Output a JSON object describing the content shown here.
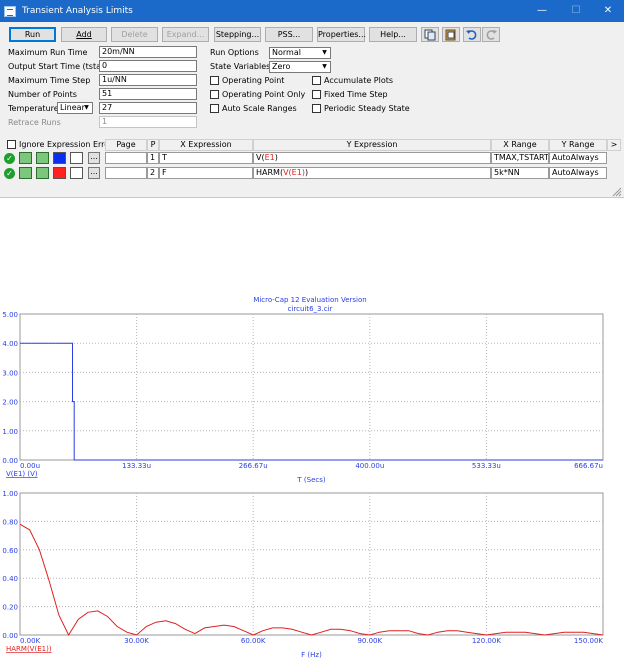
{
  "window": {
    "title": "Transient Analysis Limits",
    "controls": [
      "—",
      "☐",
      "✕"
    ]
  },
  "toolbar": {
    "run": "Run",
    "add": "Add",
    "delete": "Delete",
    "expand": "Expand...",
    "stepping": "Stepping...",
    "pss": "PSS...",
    "properties": "Properties...",
    "help": "Help..."
  },
  "fields": {
    "max_run_time": {
      "label": "Maximum Run Time",
      "value": "20m/NN"
    },
    "output_start": {
      "label": "Output Start Time (tstart)",
      "value": "0"
    },
    "max_time_step": {
      "label": "Maximum Time Step",
      "value": "1u/NN"
    },
    "num_points": {
      "label": "Number of Points",
      "value": "51"
    },
    "temperature": {
      "label": "Temperature",
      "mode": "Linear",
      "value": "27"
    },
    "retrace_runs": {
      "label": "Retrace Runs",
      "value": "1"
    }
  },
  "options": {
    "run_options_label": "Run Options",
    "run_options_value": "Normal",
    "state_variables_label": "State Variables",
    "state_variables_value": "Zero",
    "checks": {
      "operating_point": "Operating Point",
      "operating_point_only": "Operating Point Only",
      "auto_scale_ranges": "Auto Scale Ranges",
      "accumulate_plots": "Accumulate Plots",
      "fixed_time_step": "Fixed Time Step",
      "periodic_steady_state": "Periodic Steady State"
    }
  },
  "grid": {
    "ignore_label": "Ignore Expression Errors",
    "headers": {
      "page": "Page",
      "p": "P",
      "x": "X Expression",
      "y": "Y Expression",
      "xrange": "X Range",
      "yrange": "Y Range",
      "more": ">"
    },
    "rows": [
      {
        "page": "",
        "p": "1",
        "x": "T",
        "y_prefix": "V(",
        "y_mid": "E1",
        "y_suffix": ")",
        "xrange": "TMAX,TSTART",
        "yrange": "AutoAlways",
        "color": "#0a2ef0"
      },
      {
        "page": "",
        "p": "2",
        "x": "F",
        "y_prefix": "HARM(",
        "y_mid": "V(E1)",
        "y_suffix": ")",
        "xrange": "5k*NN",
        "yrange": "AutoAlways",
        "color": "#ff2020"
      }
    ]
  },
  "plot": {
    "header1": "Micro-Cap 12 Evaluation Version",
    "header2": "circuit6_3.cir",
    "top": {
      "ylabels": [
        "5.00",
        "4.00",
        "3.00",
        "2.00",
        "1.00",
        "0.00"
      ],
      "xlabels": [
        "0.00u",
        "133.33u",
        "266.67u",
        "400.00u",
        "533.33u",
        "666.67u"
      ],
      "trace_label": "V(E1) (V)",
      "xaxis_label": "T (Secs)",
      "color": "#2a3ee6"
    },
    "bottom": {
      "ylabels": [
        "1.00",
        "0.80",
        "0.60",
        "0.40",
        "0.20",
        "0.00"
      ],
      "xlabels": [
        "0.00K",
        "30.00K",
        "60.00K",
        "90.00K",
        "120.00K",
        "150.00K"
      ],
      "trace_label": "HARM(V(E1))",
      "xaxis_label": "F (Hz)",
      "color": "#e02020"
    }
  },
  "chart_data": [
    {
      "type": "line",
      "series": [
        {
          "name": "V(E1) (V)",
          "x": [
            0,
            6e-05,
            6e-05,
            6.2e-05,
            6.2e-05,
            0.0006667
          ],
          "y": [
            4,
            4,
            2,
            2,
            0,
            0
          ]
        }
      ],
      "xlabel": "T (Secs)",
      "ylabel": "",
      "xlim": [
        0,
        0.0006667
      ],
      "ylim": [
        0,
        5
      ],
      "grid": true
    },
    {
      "type": "line",
      "series": [
        {
          "name": "HARM(V(E1))",
          "x": [
            0,
            2500,
            5000,
            7500,
            10000,
            12500,
            15000,
            17500,
            20000,
            22500,
            25000,
            27500,
            30000,
            32500,
            35000,
            37500,
            40000,
            42500,
            45000,
            47500,
            50000,
            52500,
            55000,
            57500,
            60000,
            62500,
            65000,
            67500,
            70000,
            72500,
            75000,
            77500,
            80000,
            82500,
            85000,
            87500,
            90000,
            92500,
            95000,
            97500,
            100000,
            102500,
            105000,
            107500,
            110000,
            112500,
            115000,
            117500,
            120000,
            122500,
            125000,
            127500,
            130000,
            132500,
            135000,
            137500,
            140000,
            142500,
            145000,
            147500,
            150000
          ],
          "y": [
            0.78,
            0.74,
            0.6,
            0.38,
            0.14,
            0.0,
            0.11,
            0.16,
            0.17,
            0.13,
            0.06,
            0.02,
            0.0,
            0.06,
            0.09,
            0.1,
            0.08,
            0.04,
            0.01,
            0.05,
            0.06,
            0.07,
            0.06,
            0.03,
            0.0,
            0.03,
            0.05,
            0.05,
            0.04,
            0.02,
            0.0,
            0.02,
            0.04,
            0.04,
            0.03,
            0.01,
            0.0,
            0.02,
            0.03,
            0.03,
            0.03,
            0.01,
            0.0,
            0.02,
            0.03,
            0.03,
            0.02,
            0.01,
            0.0,
            0.01,
            0.02,
            0.02,
            0.02,
            0.01,
            0.0,
            0.01,
            0.02,
            0.02,
            0.02,
            0.01,
            0.0
          ]
        }
      ],
      "xlabel": "F (Hz)",
      "ylabel": "",
      "xlim": [
        0,
        150000
      ],
      "ylim": [
        0,
        1
      ],
      "grid": true
    }
  ]
}
